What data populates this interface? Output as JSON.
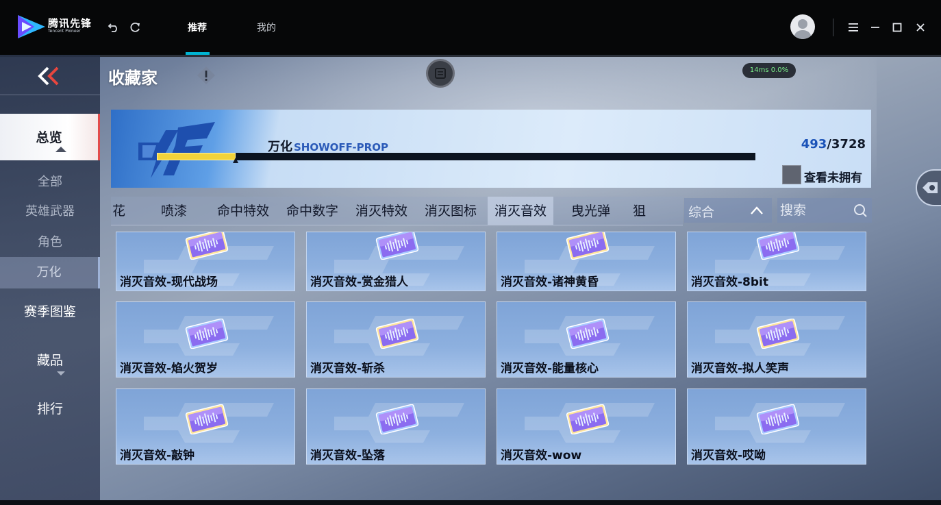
{
  "app": {
    "name_cn": "腾讯先锋",
    "name_en": "Tencent Pioneer",
    "tabs": [
      {
        "label": "推荐",
        "active": true
      },
      {
        "label": "我的",
        "active": false
      }
    ],
    "accent_color": "#00b4d2"
  },
  "game": {
    "page_title": "收藏家",
    "ping": "14ms  0.0%",
    "nav": {
      "overview": "总览",
      "sub_items": [
        "全部",
        "英雄武器",
        "角色",
        "万化"
      ],
      "active_sub": "万化",
      "season": "赛季图鉴",
      "collection": "藏品",
      "ranking": "排行"
    },
    "banner": {
      "name": "万化",
      "name_en": "SHOWOFF-PROP",
      "owned": "493",
      "total": "/3728",
      "progress": 0.132,
      "show_unowned_label": "查看未拥有"
    },
    "categories": [
      "花",
      "喷漆",
      "命中特效",
      "命中数字",
      "消灭特效",
      "消灭图标",
      "消灭音效",
      "曳光弹",
      "狙"
    ],
    "active_category": "消灭音效",
    "sort": {
      "label": "综合"
    },
    "search": {
      "placeholder": "搜索"
    },
    "items": [
      "消灭音效-现代战场",
      "消灭音效-赏金猎人",
      "消灭音效-诸神黄昏",
      "消灭音效-8bit",
      "消灭音效-焰火贺岁",
      "消灭音效-斩杀",
      "消灭音效-能量核心",
      "消灭音效-拟人笑声",
      "消灭音效-敲钟",
      "消灭音效-坠落",
      "消灭音效-wow",
      "消灭音效-哎呦"
    ]
  }
}
